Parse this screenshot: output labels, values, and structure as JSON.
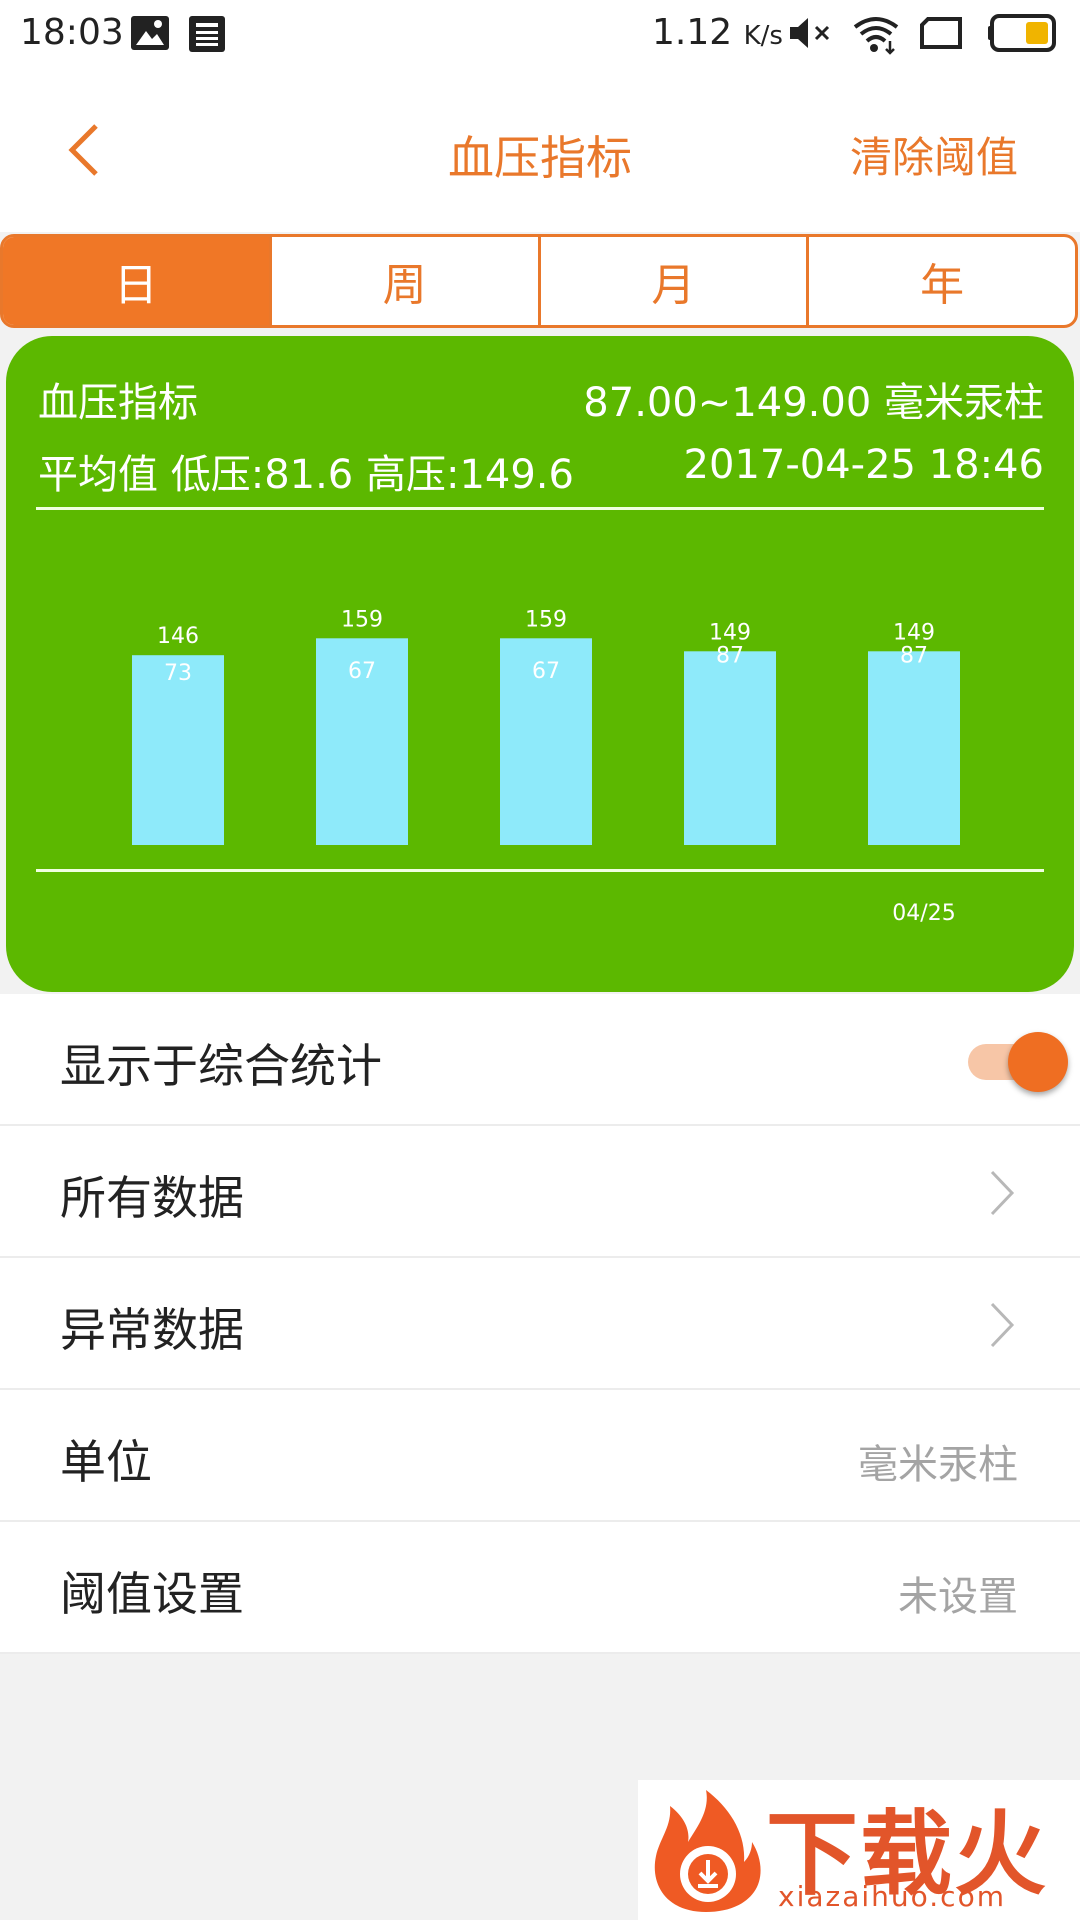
{
  "status_bar": {
    "time": "18:03",
    "speed": "1.12",
    "speed_unit": "K/s"
  },
  "header": {
    "title": "血压指标",
    "clear_label": "清除阈值"
  },
  "tabs": [
    {
      "label": "日",
      "active": true
    },
    {
      "label": "周",
      "active": false
    },
    {
      "label": "月",
      "active": false
    },
    {
      "label": "年",
      "active": false
    }
  ],
  "card": {
    "title": "血压指标",
    "range": "87.00~149.00 毫米汞柱",
    "average": "平均值 低压:81.6 高压:149.6",
    "datetime": "2017-04-25 18:46",
    "background_color": "#5cb800",
    "bar_color": "#8eeafa"
  },
  "chart_data": {
    "type": "bar",
    "categories": [
      "",
      "",
      "",
      "",
      "04/25"
    ],
    "series": [
      {
        "values": [
          146,
          159,
          159,
          149,
          149
        ]
      },
      {
        "values": [
          73,
          67,
          67,
          87,
          87
        ]
      }
    ]
  },
  "list": {
    "show_in_stats": {
      "label": "显示于综合统计",
      "enabled": true
    },
    "all_data": {
      "label": "所有数据"
    },
    "abnormal_data": {
      "label": "异常数据"
    },
    "unit": {
      "label": "单位",
      "value": "毫米汞柱"
    },
    "threshold": {
      "label": "阈值设置",
      "value": "未设置"
    }
  },
  "watermark": {
    "text": "下载火",
    "url": "xiazaihuo.com"
  },
  "colors": {
    "accent": "#e9782b",
    "tab_active": "#f07726"
  }
}
